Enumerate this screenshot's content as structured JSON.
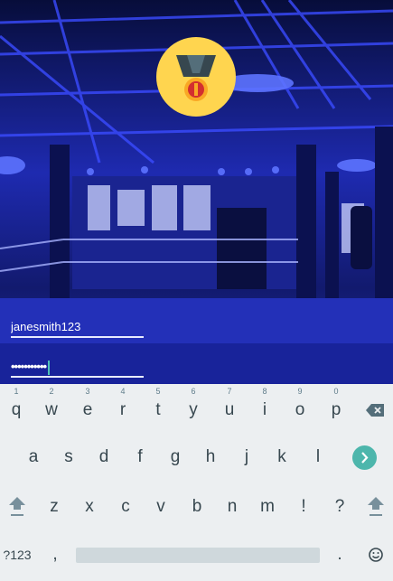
{
  "login": {
    "username_value": "janesmith123",
    "password_value": "•••••••••••"
  },
  "keyboard": {
    "row1": [
      {
        "key": "q",
        "hint": "1"
      },
      {
        "key": "w",
        "hint": "2"
      },
      {
        "key": "e",
        "hint": "3"
      },
      {
        "key": "r",
        "hint": "4"
      },
      {
        "key": "t",
        "hint": "5"
      },
      {
        "key": "y",
        "hint": "6"
      },
      {
        "key": "u",
        "hint": "7"
      },
      {
        "key": "i",
        "hint": "8"
      },
      {
        "key": "o",
        "hint": "9"
      },
      {
        "key": "p",
        "hint": "0"
      }
    ],
    "row2": [
      "a",
      "s",
      "d",
      "f",
      "g",
      "h",
      "j",
      "k",
      "l"
    ],
    "row3": [
      "z",
      "x",
      "c",
      "v",
      "b",
      "n",
      "m",
      "!",
      "?"
    ],
    "symbols_label": "?123",
    "comma": ",",
    "period": ".",
    "icons": {
      "backspace": "backspace-icon",
      "enter": "enter-arrow-icon",
      "shift": "shift-icon",
      "emoji": "emoji-icon"
    }
  },
  "colors": {
    "accent": "#4db6ac",
    "keyboard_bg": "#eceff1",
    "scene_tint": "#2a35c8",
    "badge_bg": "#ffd54f"
  },
  "icons": {
    "logo": "medal-icon"
  }
}
